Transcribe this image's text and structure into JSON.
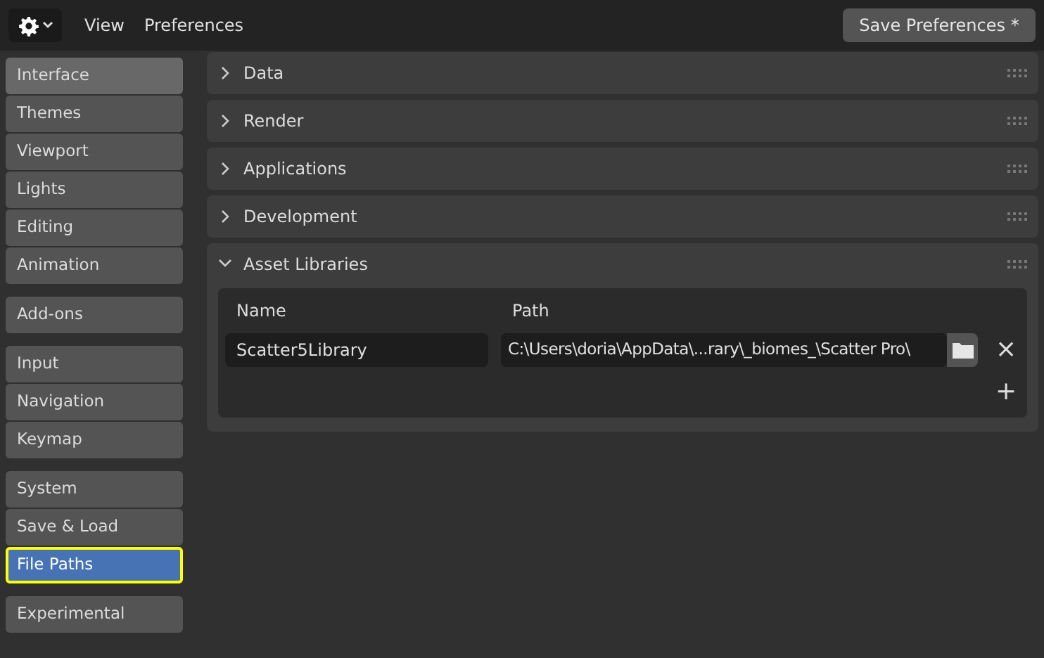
{
  "header": {
    "menu": [
      "View",
      "Preferences"
    ],
    "save_button": "Save Preferences *"
  },
  "sidebar": {
    "groups": [
      [
        {
          "label": "Interface",
          "selected": false,
          "hovered": true
        },
        {
          "label": "Themes",
          "selected": false,
          "hovered": false
        },
        {
          "label": "Viewport",
          "selected": false,
          "hovered": false
        },
        {
          "label": "Lights",
          "selected": false,
          "hovered": false
        },
        {
          "label": "Editing",
          "selected": false,
          "hovered": false
        },
        {
          "label": "Animation",
          "selected": false,
          "hovered": false
        }
      ],
      [
        {
          "label": "Add-ons",
          "selected": false,
          "hovered": false
        }
      ],
      [
        {
          "label": "Input",
          "selected": false,
          "hovered": false
        },
        {
          "label": "Navigation",
          "selected": false,
          "hovered": false
        },
        {
          "label": "Keymap",
          "selected": false,
          "hovered": false
        }
      ],
      [
        {
          "label": "System",
          "selected": false,
          "hovered": false
        },
        {
          "label": "Save & Load",
          "selected": false,
          "hovered": false
        },
        {
          "label": "File Paths",
          "selected": true,
          "hovered": false
        }
      ],
      [
        {
          "label": "Experimental",
          "selected": false,
          "hovered": false
        }
      ]
    ]
  },
  "panels": [
    {
      "title": "Data",
      "expanded": false
    },
    {
      "title": "Render",
      "expanded": false
    },
    {
      "title": "Applications",
      "expanded": false
    },
    {
      "title": "Development",
      "expanded": false
    },
    {
      "title": "Asset Libraries",
      "expanded": true,
      "columns": [
        "Name",
        "Path"
      ],
      "rows": [
        {
          "name": "Scatter5Library",
          "path": "C:\\Users\\doria\\AppData\\...rary\\_biomes_\\Scatter Pro\\"
        }
      ],
      "remove": "×",
      "add": "+"
    }
  ]
}
